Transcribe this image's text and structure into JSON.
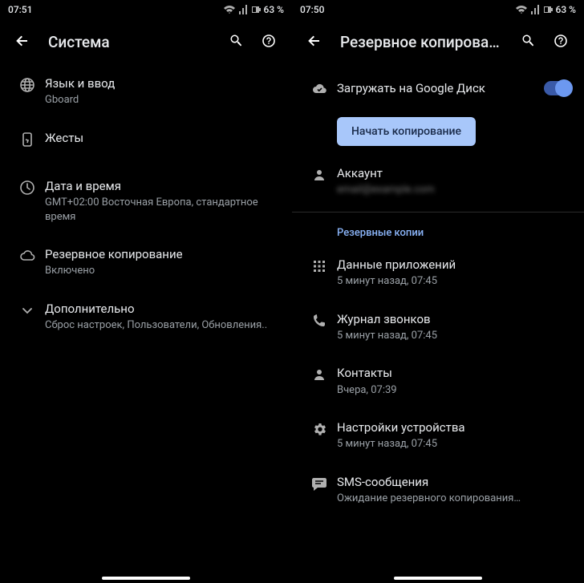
{
  "left": {
    "status": {
      "time": "07:51",
      "battery": "63 %"
    },
    "title": "Система",
    "items": [
      {
        "icon": "globe",
        "title": "Язык и ввод",
        "sub": "Gboard"
      },
      {
        "icon": "gesture",
        "title": "Жесты",
        "sub": ""
      },
      {
        "icon": "clock",
        "title": "Дата и время",
        "sub": "GMT+02:00 Восточная Европа, стандартное время"
      },
      {
        "icon": "cloud",
        "title": "Резервное копирование",
        "sub": "Включено"
      },
      {
        "icon": "chevron",
        "title": "Дополнительно",
        "sub": "Сброс настроек, Пользователи, Обновления.."
      }
    ]
  },
  "right": {
    "status": {
      "time": "07:50",
      "battery": "63 %"
    },
    "title": "Резервное копирова…",
    "backup_toggle": {
      "title": "Загружать на Google Диск",
      "on": true
    },
    "start_button": "Начать копирование",
    "account": {
      "title": "Аккаунт",
      "value": "email@example.com"
    },
    "section": "Резервные копии",
    "items": [
      {
        "icon": "apps",
        "title": "Данные приложений",
        "sub": "5 минут назад, 07:45"
      },
      {
        "icon": "phone",
        "title": "Журнал звонков",
        "sub": "5 минут назад, 07:45"
      },
      {
        "icon": "person",
        "title": "Контакты",
        "sub": "Вчера, 07:39"
      },
      {
        "icon": "gear",
        "title": "Настройки устройства",
        "sub": "5 минут назад, 07:45"
      },
      {
        "icon": "sms",
        "title": "SMS-сообщения",
        "sub": "Ожидание резервного копирования…"
      }
    ]
  }
}
